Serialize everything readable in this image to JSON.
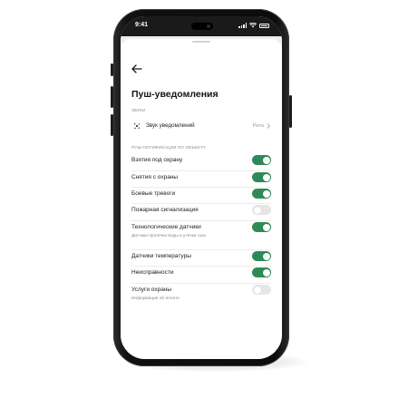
{
  "status_bar": {
    "time": "9:41"
  },
  "header": {
    "title": "Пуш-уведомления"
  },
  "sections": {
    "sounds_label": "ЗВУКИ",
    "object_notifications_label": "ПУШ-НОТИФИКАЦИИ ПО ОБЪЕКТУ"
  },
  "sound_row": {
    "label": "Звук уведомлений",
    "value": "Рита"
  },
  "toggles": [
    {
      "label": "Взятия под охрану",
      "on": true,
      "subtitle": ""
    },
    {
      "label": "Снятия с охраны",
      "on": true,
      "subtitle": ""
    },
    {
      "label": "Боевые тревоги",
      "on": true,
      "subtitle": ""
    },
    {
      "label": "Пожарная сигнализация",
      "on": false,
      "subtitle": ""
    },
    {
      "label": "Технологические датчики",
      "on": true,
      "subtitle": "Датчики протечки воды и утечки газа"
    },
    {
      "label": "Датчики температуры",
      "on": true,
      "subtitle": ""
    },
    {
      "label": "Неисправности",
      "on": true,
      "subtitle": ""
    },
    {
      "label": "Услуги охраны",
      "on": false,
      "subtitle": "Информация об оплате"
    }
  ],
  "colors": {
    "toggle_on": "#2e8b57",
    "toggle_off": "#e6e6e6"
  }
}
